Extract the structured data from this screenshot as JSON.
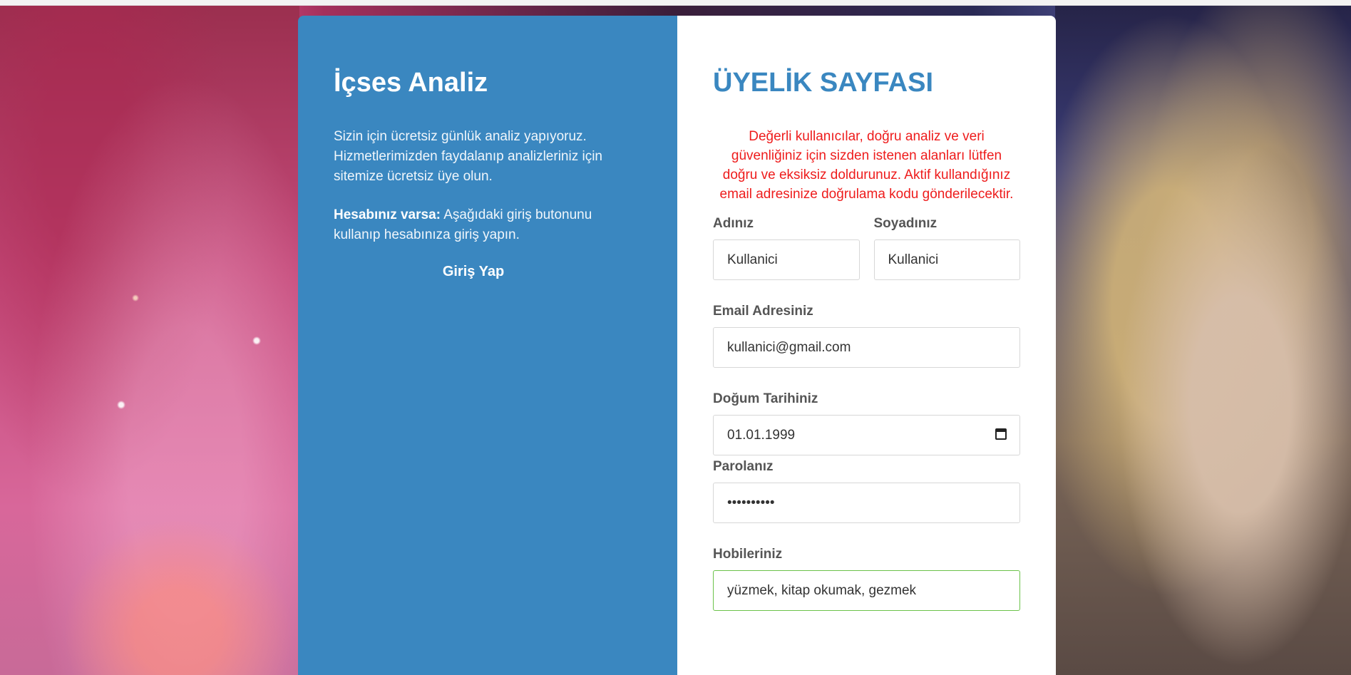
{
  "left": {
    "brand": "İçses Analiz",
    "intro": "Sizin için ücretsiz günlük analiz yapıyoruz. Hizmetlerimizden faydalanıp analizleriniz için sitemize ücretsiz üye olun.",
    "account_bold": "Hesabınız varsa:",
    "account_text": " Aşağıdaki giriş butonunu kullanıp hesabınıza giriş yapın.",
    "login_label": "Giriş Yap"
  },
  "right": {
    "title": "ÜYELİK SAYFASI",
    "notice": "Değerli kullanıcılar, doğru analiz ve veri güvenliğiniz için sizden istenen alanları lütfen doğru ve eksiksiz doldurunuz. Aktif kullandığınız email adresinize doğrulama kodu gönderilecektir.",
    "first_name": {
      "label": "Adınız",
      "value": "Kullanici"
    },
    "last_name": {
      "label": "Soyadınız",
      "value": "Kullanici"
    },
    "email": {
      "label": "Email Adresiniz",
      "value": "kullanici@gmail.com"
    },
    "birth_date": {
      "label": "Doğum Tarihiniz",
      "value": "01.01.1999"
    },
    "password": {
      "label": "Parolanız",
      "value": "••••••••••"
    },
    "hobbies": {
      "label": "Hobileriniz",
      "value": "yüzmek, kitap okumak, gezmek"
    }
  },
  "colors": {
    "accent": "#3a87c0",
    "notice": "#ee1c1c",
    "focus": "#6bc24a"
  },
  "icons": {
    "calendar": "calendar-icon"
  }
}
